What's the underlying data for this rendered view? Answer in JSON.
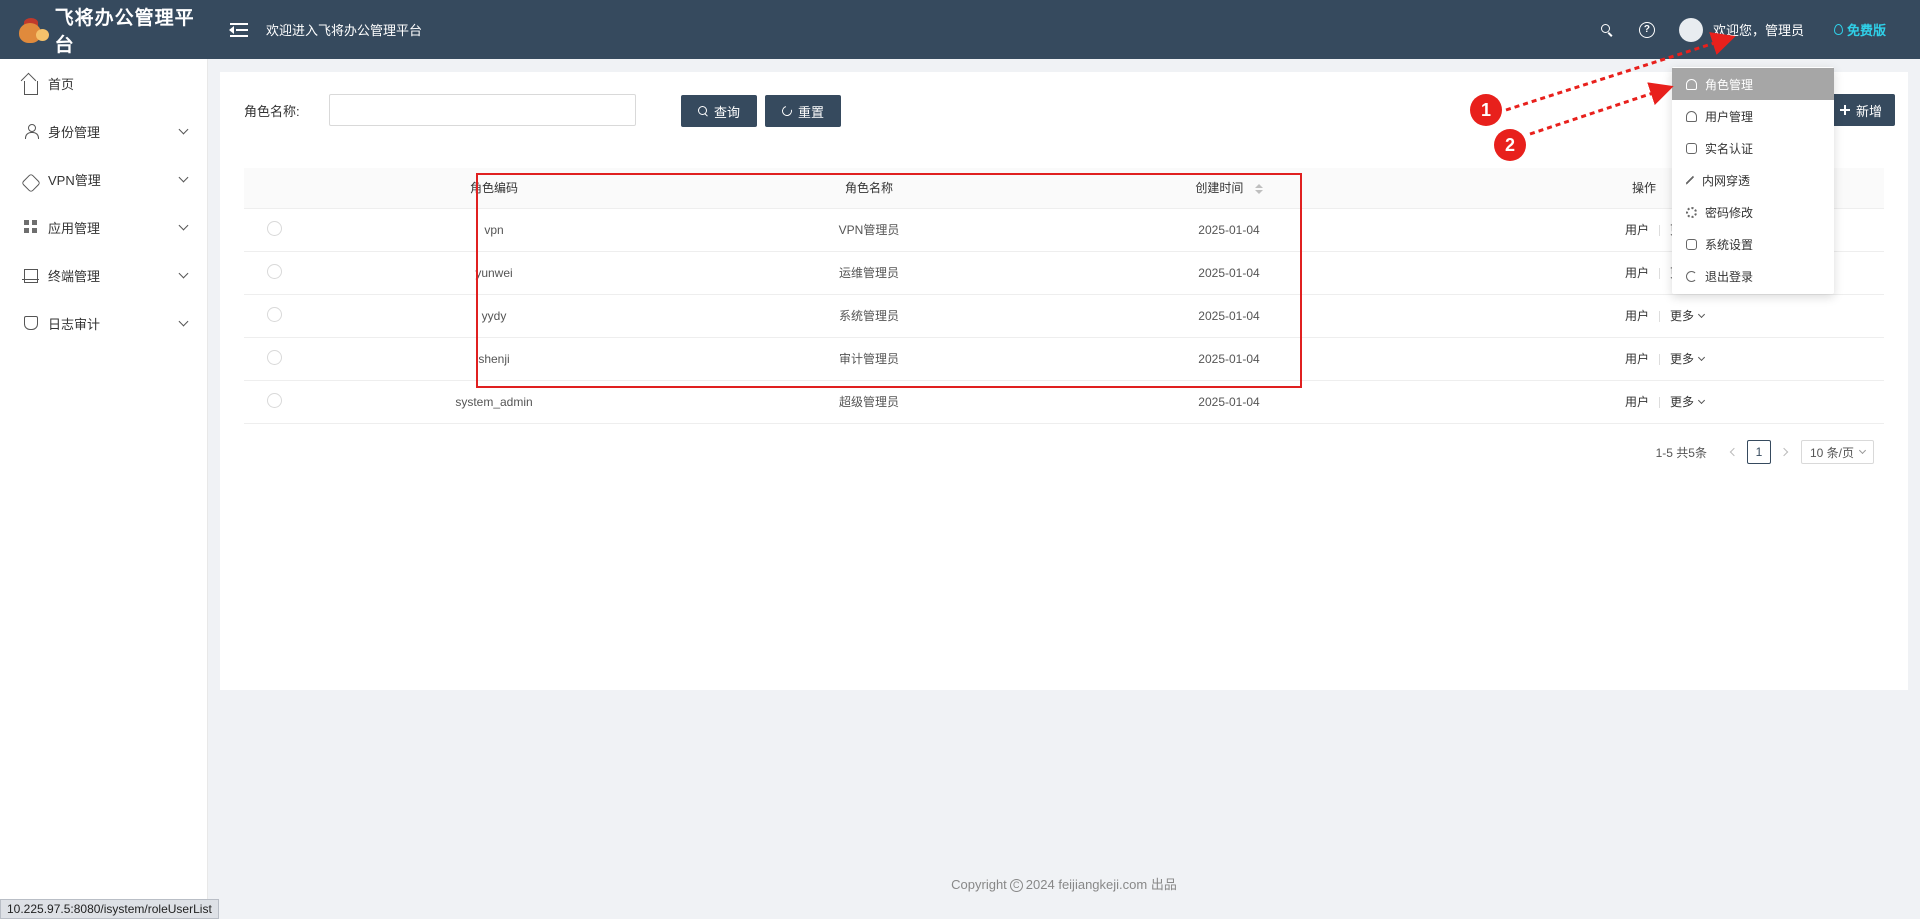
{
  "header": {
    "app_title": "飞将办公管理平台",
    "welcome_text": "欢迎进入飞将办公管理平台",
    "user_greeting": "欢迎您，管理员",
    "edition_badge": "免费版"
  },
  "sidebar": {
    "items": [
      {
        "label": "首页",
        "icon": "home-icon",
        "expandable": false
      },
      {
        "label": "身份管理",
        "icon": "user-icon",
        "expandable": true
      },
      {
        "label": "VPN管理",
        "icon": "link-icon",
        "expandable": true
      },
      {
        "label": "应用管理",
        "icon": "apps-icon",
        "expandable": true
      },
      {
        "label": "终端管理",
        "icon": "terminal-icon",
        "expandable": true
      },
      {
        "label": "日志审计",
        "icon": "shield-icon",
        "expandable": true
      }
    ]
  },
  "filter": {
    "label": "角色名称:",
    "input_value": "",
    "query_button": "查询",
    "reset_button": "重置",
    "add_button": "新增"
  },
  "table": {
    "headers": {
      "code": "角色编码",
      "name": "角色名称",
      "time": "创建时间",
      "op": "操作"
    },
    "rows": [
      {
        "code": "vpn",
        "name": "VPN管理员",
        "time": "2025-01-04"
      },
      {
        "code": "yunwei",
        "name": "运维管理员",
        "time": "2025-01-04"
      },
      {
        "code": "yydy",
        "name": "系统管理员",
        "time": "2025-01-04"
      },
      {
        "code": "shenji",
        "name": "审计管理员",
        "time": "2025-01-04"
      },
      {
        "code": "system_admin",
        "name": "超级管理员",
        "time": "2025-01-04"
      }
    ],
    "op_user_label": "用户",
    "op_more_label": "更多"
  },
  "pagination": {
    "total_text": "1-5 共5条",
    "current_page": "1",
    "page_size": "10 条/页"
  },
  "dropdown": {
    "items": [
      {
        "label": "角色管理",
        "icon": "role-icon",
        "active": true
      },
      {
        "label": "用户管理",
        "icon": "user-icon",
        "active": false
      },
      {
        "label": "实名认证",
        "icon": "edit-icon",
        "active": false
      },
      {
        "label": "内网穿透",
        "icon": "bolt-icon",
        "active": false
      },
      {
        "label": "密码修改",
        "icon": "gear-icon",
        "active": false
      },
      {
        "label": "系统设置",
        "icon": "wrench-icon",
        "active": false
      },
      {
        "label": "退出登录",
        "icon": "logout-icon",
        "active": false
      }
    ]
  },
  "annotations": {
    "badge_1": "1",
    "badge_2": "2",
    "callout_color": "#e8201c"
  },
  "footer": {
    "copyright_prefix": "Copyright",
    "copyright_suffix": "2024 feijiangkeji.com 出品"
  },
  "statusbar": {
    "url": "10.225.97.5:8080/isystem/roleUserList"
  },
  "colors": {
    "header_bg": "#364a5e",
    "accent": "#2fd0e8",
    "highlight": "#e02020"
  }
}
